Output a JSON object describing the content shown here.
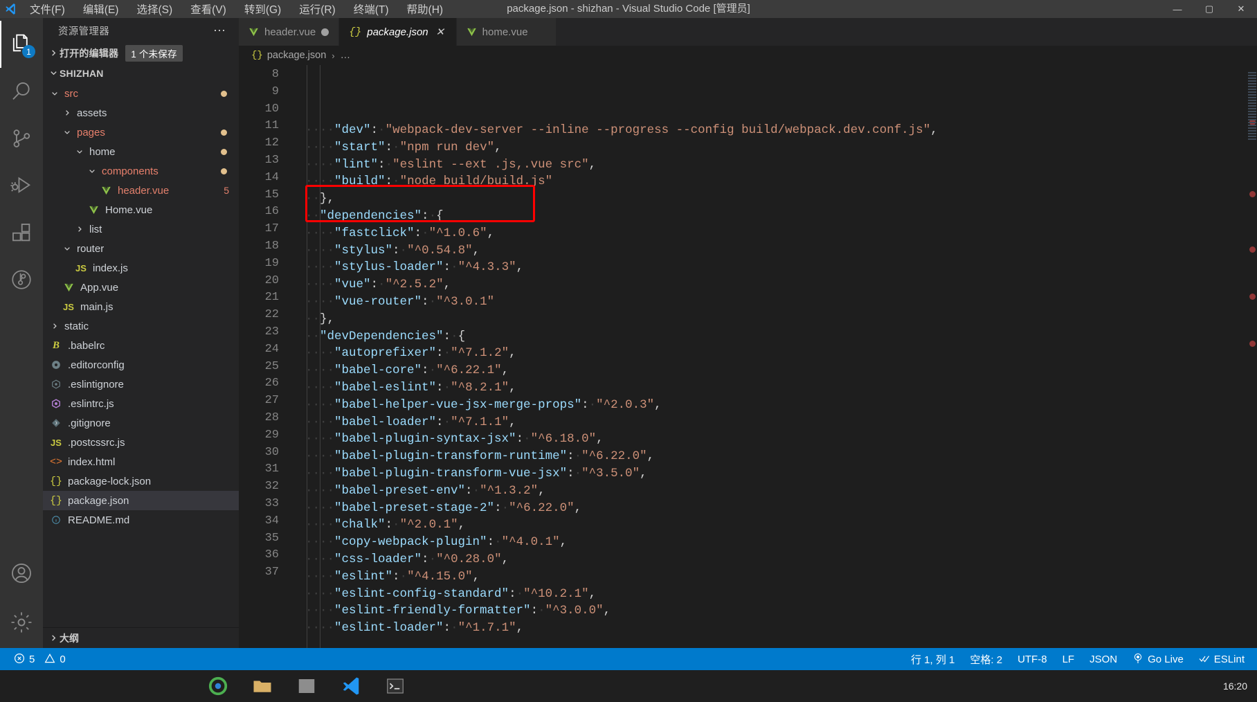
{
  "window": {
    "title": "package.json - shizhan - Visual Studio Code [管理员]",
    "minimize": "—",
    "maximize": "▢",
    "close": "✕"
  },
  "menu": [
    {
      "label": "文件(F)"
    },
    {
      "label": "编辑(E)"
    },
    {
      "label": "选择(S)"
    },
    {
      "label": "查看(V)"
    },
    {
      "label": "转到(G)"
    },
    {
      "label": "运行(R)"
    },
    {
      "label": "终端(T)"
    },
    {
      "label": "帮助(H)"
    }
  ],
  "activitybar": {
    "items": [
      {
        "name": "explorer",
        "badge": "1"
      },
      {
        "name": "search",
        "badge": ""
      },
      {
        "name": "source-control",
        "badge": ""
      },
      {
        "name": "run-and-debug",
        "badge": ""
      },
      {
        "name": "extensions",
        "badge": ""
      },
      {
        "name": "remote",
        "badge": ""
      }
    ],
    "bottom": [
      {
        "name": "accounts"
      },
      {
        "name": "settings"
      }
    ]
  },
  "sidebar": {
    "title": "资源管理器",
    "more_actions": "⋯",
    "open_editors": {
      "label": "打开的编辑器",
      "badge": "1 个未保存"
    },
    "folder": "SHIZHAN",
    "outline": "大纲",
    "tree": [
      {
        "label": "src",
        "indent": 1,
        "type": "folder",
        "state": "open",
        "icon": "",
        "color": "folder-name",
        "right": ""
      },
      {
        "label": "assets",
        "indent": 2,
        "type": "folder",
        "state": "closed",
        "icon": "",
        "color": "file-plain",
        "right": ""
      },
      {
        "label": "pages",
        "indent": 2,
        "type": "folder",
        "state": "open",
        "icon": "",
        "color": "folder-name",
        "right": ""
      },
      {
        "label": "home",
        "indent": 3,
        "type": "folder",
        "state": "open",
        "icon": "",
        "color": "file-plain",
        "right": ""
      },
      {
        "label": "components",
        "indent": 4,
        "type": "folder",
        "state": "open",
        "icon": "",
        "color": "folder-name",
        "right": ""
      },
      {
        "label": "header.vue",
        "indent": 5,
        "type": "file",
        "state": "",
        "icon": "vue",
        "color": "file-mod",
        "right": "5"
      },
      {
        "label": "Home.vue",
        "indent": 4,
        "type": "file",
        "state": "",
        "icon": "vue",
        "color": "file-plain",
        "right": ""
      },
      {
        "label": "list",
        "indent": 3,
        "type": "folder",
        "state": "closed",
        "icon": "",
        "color": "file-plain",
        "right": ""
      },
      {
        "label": "router",
        "indent": 2,
        "type": "folder",
        "state": "open",
        "icon": "",
        "color": "file-plain",
        "right": ""
      },
      {
        "label": "index.js",
        "indent": 3,
        "type": "file",
        "state": "",
        "icon": "js",
        "color": "file-plain",
        "right": ""
      },
      {
        "label": "App.vue",
        "indent": 2,
        "type": "file",
        "state": "",
        "icon": "vue",
        "color": "file-plain",
        "right": ""
      },
      {
        "label": "main.js",
        "indent": 2,
        "type": "file",
        "state": "",
        "icon": "js",
        "color": "file-plain",
        "right": ""
      },
      {
        "label": "static",
        "indent": 1,
        "type": "folder",
        "state": "closed",
        "icon": "",
        "color": "file-plain",
        "right": ""
      },
      {
        "label": ".babelrc",
        "indent": 1,
        "type": "file",
        "state": "",
        "icon": "babel",
        "color": "file-plain",
        "right": ""
      },
      {
        "label": ".editorconfig",
        "indent": 1,
        "type": "file",
        "state": "",
        "icon": "gear",
        "color": "file-plain",
        "right": ""
      },
      {
        "label": ".eslintignore",
        "indent": 1,
        "type": "file",
        "state": "",
        "icon": "eslint-gray",
        "color": "file-plain",
        "right": ""
      },
      {
        "label": ".eslintrc.js",
        "indent": 1,
        "type": "file",
        "state": "",
        "icon": "eslint",
        "color": "file-plain",
        "right": ""
      },
      {
        "label": ".gitignore",
        "indent": 1,
        "type": "file",
        "state": "",
        "icon": "git",
        "color": "file-plain",
        "right": ""
      },
      {
        "label": ".postcssrc.js",
        "indent": 1,
        "type": "file",
        "state": "",
        "icon": "js",
        "color": "file-plain",
        "right": ""
      },
      {
        "label": "index.html",
        "indent": 1,
        "type": "file",
        "state": "",
        "icon": "html",
        "color": "file-plain",
        "right": ""
      },
      {
        "label": "package-lock.json",
        "indent": 1,
        "type": "file",
        "state": "",
        "icon": "json",
        "color": "file-plain",
        "right": ""
      },
      {
        "label": "package.json",
        "indent": 1,
        "type": "file",
        "state": "",
        "icon": "json",
        "color": "file-plain",
        "right": "",
        "selected": true
      },
      {
        "label": "README.md",
        "indent": 1,
        "type": "file",
        "state": "",
        "icon": "info",
        "color": "file-plain",
        "right": ""
      }
    ]
  },
  "tabs": [
    {
      "label": "header.vue",
      "icon": "vue",
      "active": false,
      "dirty": true,
      "close": ""
    },
    {
      "label": "package.json",
      "icon": "json",
      "active": true,
      "dirty": false,
      "close": "✕"
    },
    {
      "label": "home.vue",
      "icon": "vue",
      "active": false,
      "dirty": false,
      "close": ""
    }
  ],
  "breadcrumb": {
    "icon": "{}",
    "file": "package.json",
    "separator": "›",
    "rest": "…"
  },
  "editor": {
    "first_line": 8,
    "lines": [
      {
        "n": 8,
        "indent": 4,
        "key": "\"dev\"",
        "sep": ": ",
        "val": "\"webpack-dev-server --inline --progress --config build/webpack.dev.conf.js\"",
        "tail": ","
      },
      {
        "n": 9,
        "indent": 4,
        "key": "\"start\"",
        "sep": ": ",
        "val": "\"npm run dev\"",
        "tail": ","
      },
      {
        "n": 10,
        "indent": 4,
        "key": "\"lint\"",
        "sep": ": ",
        "val": "\"eslint --ext .js,.vue src\"",
        "tail": ","
      },
      {
        "n": 11,
        "indent": 4,
        "key": "\"build\"",
        "sep": ": ",
        "val": "\"node build/build.js\"",
        "tail": ""
      },
      {
        "n": 12,
        "indent": 2,
        "key": "",
        "sep": "",
        "val": "",
        "tail": "},",
        "brace": true
      },
      {
        "n": 13,
        "indent": 2,
        "key": "\"dependencies\"",
        "sep": ": ",
        "val": "",
        "tail": "{",
        "braceTail": true
      },
      {
        "n": 14,
        "indent": 4,
        "key": "\"fastclick\"",
        "sep": ": ",
        "val": "\"^1.0.6\"",
        "tail": ","
      },
      {
        "n": 15,
        "indent": 4,
        "key": "\"stylus\"",
        "sep": ": ",
        "val": "\"^0.54.8\"",
        "tail": ","
      },
      {
        "n": 16,
        "indent": 4,
        "key": "\"stylus-loader\"",
        "sep": ": ",
        "val": "\"^4.3.3\"",
        "tail": ","
      },
      {
        "n": 17,
        "indent": 4,
        "key": "\"vue\"",
        "sep": ": ",
        "val": "\"^2.5.2\"",
        "tail": ","
      },
      {
        "n": 18,
        "indent": 4,
        "key": "\"vue-router\"",
        "sep": ": ",
        "val": "\"^3.0.1\"",
        "tail": ""
      },
      {
        "n": 19,
        "indent": 2,
        "key": "",
        "sep": "",
        "val": "",
        "tail": "},",
        "brace": true
      },
      {
        "n": 20,
        "indent": 2,
        "key": "\"devDependencies\"",
        "sep": ": ",
        "val": "",
        "tail": "{",
        "braceTail": true
      },
      {
        "n": 21,
        "indent": 4,
        "key": "\"autoprefixer\"",
        "sep": ": ",
        "val": "\"^7.1.2\"",
        "tail": ","
      },
      {
        "n": 22,
        "indent": 4,
        "key": "\"babel-core\"",
        "sep": ": ",
        "val": "\"^6.22.1\"",
        "tail": ","
      },
      {
        "n": 23,
        "indent": 4,
        "key": "\"babel-eslint\"",
        "sep": ": ",
        "val": "\"^8.2.1\"",
        "tail": ","
      },
      {
        "n": 24,
        "indent": 4,
        "key": "\"babel-helper-vue-jsx-merge-props\"",
        "sep": ": ",
        "val": "\"^2.0.3\"",
        "tail": ","
      },
      {
        "n": 25,
        "indent": 4,
        "key": "\"babel-loader\"",
        "sep": ": ",
        "val": "\"^7.1.1\"",
        "tail": ","
      },
      {
        "n": 26,
        "indent": 4,
        "key": "\"babel-plugin-syntax-jsx\"",
        "sep": ": ",
        "val": "\"^6.18.0\"",
        "tail": ","
      },
      {
        "n": 27,
        "indent": 4,
        "key": "\"babel-plugin-transform-runtime\"",
        "sep": ": ",
        "val": "\"^6.22.0\"",
        "tail": ","
      },
      {
        "n": 28,
        "indent": 4,
        "key": "\"babel-plugin-transform-vue-jsx\"",
        "sep": ": ",
        "val": "\"^3.5.0\"",
        "tail": ","
      },
      {
        "n": 29,
        "indent": 4,
        "key": "\"babel-preset-env\"",
        "sep": ": ",
        "val": "\"^1.3.2\"",
        "tail": ","
      },
      {
        "n": 30,
        "indent": 4,
        "key": "\"babel-preset-stage-2\"",
        "sep": ": ",
        "val": "\"^6.22.0\"",
        "tail": ","
      },
      {
        "n": 31,
        "indent": 4,
        "key": "\"chalk\"",
        "sep": ": ",
        "val": "\"^2.0.1\"",
        "tail": ","
      },
      {
        "n": 32,
        "indent": 4,
        "key": "\"copy-webpack-plugin\"",
        "sep": ": ",
        "val": "\"^4.0.1\"",
        "tail": ","
      },
      {
        "n": 33,
        "indent": 4,
        "key": "\"css-loader\"",
        "sep": ": ",
        "val": "\"^0.28.0\"",
        "tail": ","
      },
      {
        "n": 34,
        "indent": 4,
        "key": "\"eslint\"",
        "sep": ": ",
        "val": "\"^4.15.0\"",
        "tail": ","
      },
      {
        "n": 35,
        "indent": 4,
        "key": "\"eslint-config-standard\"",
        "sep": ": ",
        "val": "\"^10.2.1\"",
        "tail": ","
      },
      {
        "n": 36,
        "indent": 4,
        "key": "\"eslint-friendly-formatter\"",
        "sep": ": ",
        "val": "\"^3.0.0\"",
        "tail": ","
      },
      {
        "n": 37,
        "indent": 4,
        "key": "\"eslint-loader\"",
        "sep": ": ",
        "val": "\"^1.7.1\"",
        "tail": ","
      }
    ],
    "annotation": {
      "label": "red-highlight-box",
      "color": "#ff0000",
      "lines": [
        15,
        16
      ]
    }
  },
  "statusbar": {
    "errors": "5",
    "warnings": "0",
    "position": "行 1, 列 1",
    "indent": "空格: 2",
    "encoding": "UTF-8",
    "eol": "LF",
    "language": "JSON",
    "golive": "Go Live",
    "eslint": "ESLint"
  },
  "taskbar": {
    "time": "16:20"
  },
  "colors": {
    "accent": "#007acc",
    "annotation": "#ff0000",
    "modified": "#e2c08d",
    "key": "#9cdcfe",
    "string": "#ce9178"
  }
}
